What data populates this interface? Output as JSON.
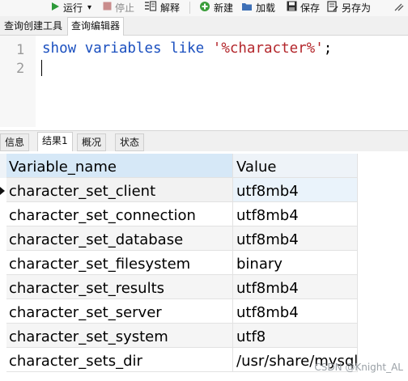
{
  "toolbar": {
    "run_label": "运行",
    "run_caret": "▾",
    "stop_label": "停止",
    "explain_label": "解释",
    "new_label": "新建",
    "load_label": "加载",
    "save_label": "保存",
    "saveas_label": "另存为"
  },
  "query_tabs": [
    {
      "label": "查询创建工具"
    },
    {
      "label": "查询编辑器"
    }
  ],
  "editor": {
    "line_numbers": [
      "1",
      "2"
    ],
    "code_tokens": [
      {
        "text": "show",
        "kind": "kw"
      },
      {
        "text": " ",
        "kind": "plain"
      },
      {
        "text": "variables",
        "kind": "kw"
      },
      {
        "text": " ",
        "kind": "plain"
      },
      {
        "text": "like",
        "kind": "kw"
      },
      {
        "text": " ",
        "kind": "plain"
      },
      {
        "text": "'%character%'",
        "kind": "str"
      },
      {
        "text": ";",
        "kind": "plain"
      }
    ]
  },
  "result_tabs": [
    {
      "label": "信息"
    },
    {
      "label": "结果1"
    },
    {
      "label": "概况"
    },
    {
      "label": "状态"
    }
  ],
  "grid": {
    "columns": [
      "Variable_name",
      "Value"
    ],
    "rows": [
      [
        "character_set_client",
        "utf8mb4"
      ],
      [
        "character_set_connection",
        "utf8mb4"
      ],
      [
        "character_set_database",
        "utf8mb4"
      ],
      [
        "character_set_filesystem",
        "binary"
      ],
      [
        "character_set_results",
        "utf8mb4"
      ],
      [
        "character_set_server",
        "utf8mb4"
      ],
      [
        "character_set_system",
        "utf8"
      ],
      [
        "character_sets_dir",
        "/usr/share/mysql"
      ]
    ]
  },
  "watermark": "CSDN @Knight_AL",
  "colors": {
    "keyword": "#1a4fbf",
    "string": "#b3262b",
    "run_icon": "#2e9a3a",
    "stop_icon": "#c24545",
    "new_icon": "#3a9d3a"
  }
}
